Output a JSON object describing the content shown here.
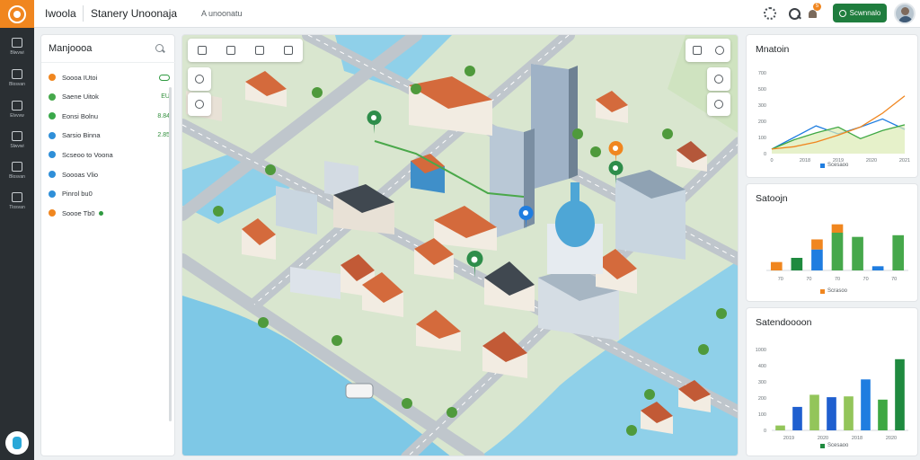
{
  "app": {
    "title": "Iwoola",
    "page_title": "Stanery Unoonaja",
    "breadcrumb": "A unoonatu"
  },
  "rail": {
    "items": [
      {
        "label": "Blwvwi",
        "icon": "home-icon"
      },
      {
        "label": "Blosvan",
        "icon": "calendar-icon"
      },
      {
        "label": "Elvvvw",
        "icon": "chart-icon"
      },
      {
        "label": "Slwvwi",
        "icon": "clock-icon"
      },
      {
        "label": "Blosvan",
        "icon": "image-icon"
      },
      {
        "label": "Tlosvan",
        "icon": "document-icon"
      }
    ]
  },
  "topbar": {
    "notification_count": "5",
    "cta_label": "Scwnnalo"
  },
  "panel": {
    "title": "Manjoooa",
    "layers": [
      {
        "label": "Soooa IUtoi",
        "color": "#f0861f",
        "value": "",
        "control": "toggle"
      },
      {
        "label": "Saene Uitok",
        "color": "#46a84b",
        "value": "EU",
        "control": "value"
      },
      {
        "label": "Eonsi Bolnu",
        "color": "#3aa84a",
        "value": "8.84",
        "control": "value"
      },
      {
        "label": "Sarsio Binna",
        "color": "#2f8fd8",
        "value": "2.85",
        "control": "value"
      },
      {
        "label": "Scseoo to Voona",
        "color": "#2f8fd8",
        "value": "",
        "control": "none"
      },
      {
        "label": "Soooas Vlio",
        "color": "#2f8fd8",
        "value": "",
        "control": "none"
      },
      {
        "label": "Pinrol bu0",
        "color": "#2f8fd8",
        "value": "",
        "control": "none"
      },
      {
        "label": "Soooe Tb0",
        "color": "#f0861f",
        "value": "",
        "control": "dot"
      }
    ]
  },
  "charts": {
    "top": {
      "title": "Mnatoin",
      "legend": "Scesaoo",
      "chart_data": {
        "type": "area",
        "x": [
          "0",
          "2018",
          "2019",
          "2020",
          "2021"
        ],
        "yticks": [
          "0",
          "100",
          "200",
          "300",
          "500",
          "700"
        ],
        "ylim": [
          0,
          700
        ],
        "series": [
          {
            "color": "#1f7de0",
            "values": [
              40,
              140,
              240,
              170,
              230,
              300,
              210
            ]
          },
          {
            "color": "#3ea843",
            "values": [
              40,
              120,
              180,
              230,
              130,
              200,
              250
            ]
          },
          {
            "color": "#f0861f",
            "values": [
              40,
              60,
              100,
              160,
              230,
              350,
              500
            ]
          }
        ]
      }
    },
    "middle": {
      "title": "Satoojn",
      "legend": "Scrasoo",
      "chart_data": {
        "type": "bar",
        "x": [
          "70",
          "70",
          "70",
          "70",
          "70"
        ],
        "ylim": [
          0,
          60
        ],
        "bars": [
          {
            "value": 10,
            "color": "#f0861f"
          },
          {
            "value": 15,
            "color": "#1f8a3f"
          },
          {
            "value": 25,
            "color": "#1f7de0",
            "cap": 12,
            "cap_color": "#f0861f"
          },
          {
            "value": 45,
            "color": "#46a84b",
            "cap": 10,
            "cap_color": "#f0861f"
          },
          {
            "value": 40,
            "color": "#46a84b"
          },
          {
            "value": 5,
            "color": "#1f7de0"
          },
          {
            "value": 42,
            "color": "#46a84b"
          }
        ]
      }
    },
    "bottom": {
      "title": "Satendoooon",
      "legend": "Scesaoo",
      "chart_data": {
        "type": "bar",
        "x": [
          "2019",
          "2020",
          "2018",
          "2020"
        ],
        "yticks": [
          "0",
          "100",
          "200",
          "300",
          "400",
          "1000"
        ],
        "ylim": [
          0,
          1000
        ],
        "bars": [
          {
            "value": 60,
            "color": "#93c55a"
          },
          {
            "value": 290,
            "color": "#1f5fcf"
          },
          {
            "value": 440,
            "color": "#93c55a"
          },
          {
            "value": 410,
            "color": "#1f5fcf"
          },
          {
            "value": 420,
            "color": "#93c55a"
          },
          {
            "value": 630,
            "color": "#1f7de0"
          },
          {
            "value": 380,
            "color": "#3ea843"
          },
          {
            "value": 880,
            "color": "#1f8a3f"
          }
        ]
      }
    }
  }
}
